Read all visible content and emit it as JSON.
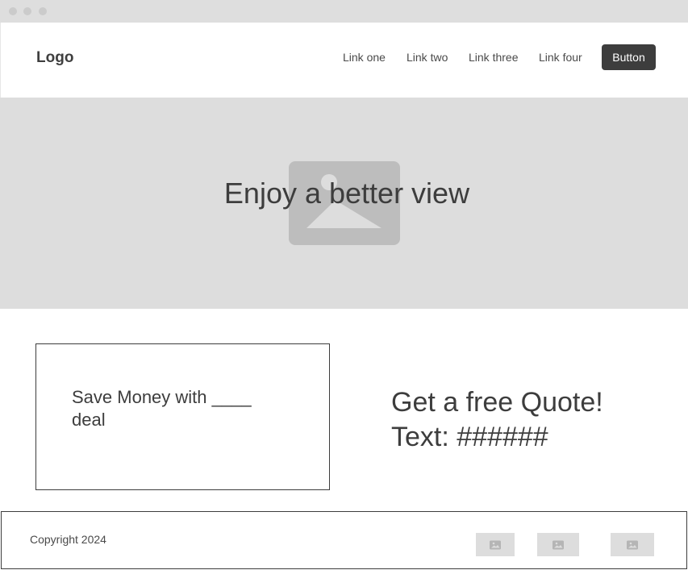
{
  "header": {
    "logo": "Logo",
    "nav_links": [
      "Link one",
      "Link two",
      "Link three",
      "Link four"
    ],
    "button_label": "Button"
  },
  "hero": {
    "title": "Enjoy a better view",
    "image_icon": "image-placeholder-icon"
  },
  "content": {
    "deal_text": "Save Money with ____ deal",
    "quote_line1": "Get a free Quote!",
    "quote_line2": "Text: ######"
  },
  "footer": {
    "copyright": "Copyright 2024",
    "image_icons": [
      "image-placeholder-icon",
      "image-placeholder-icon",
      "image-placeholder-icon"
    ]
  },
  "colors": {
    "chrome": "#dedede",
    "hero_bg": "#dddddd",
    "placeholder": "#bdbdbd",
    "button_bg": "#3d3d3d",
    "text": "#3d3d3d"
  }
}
